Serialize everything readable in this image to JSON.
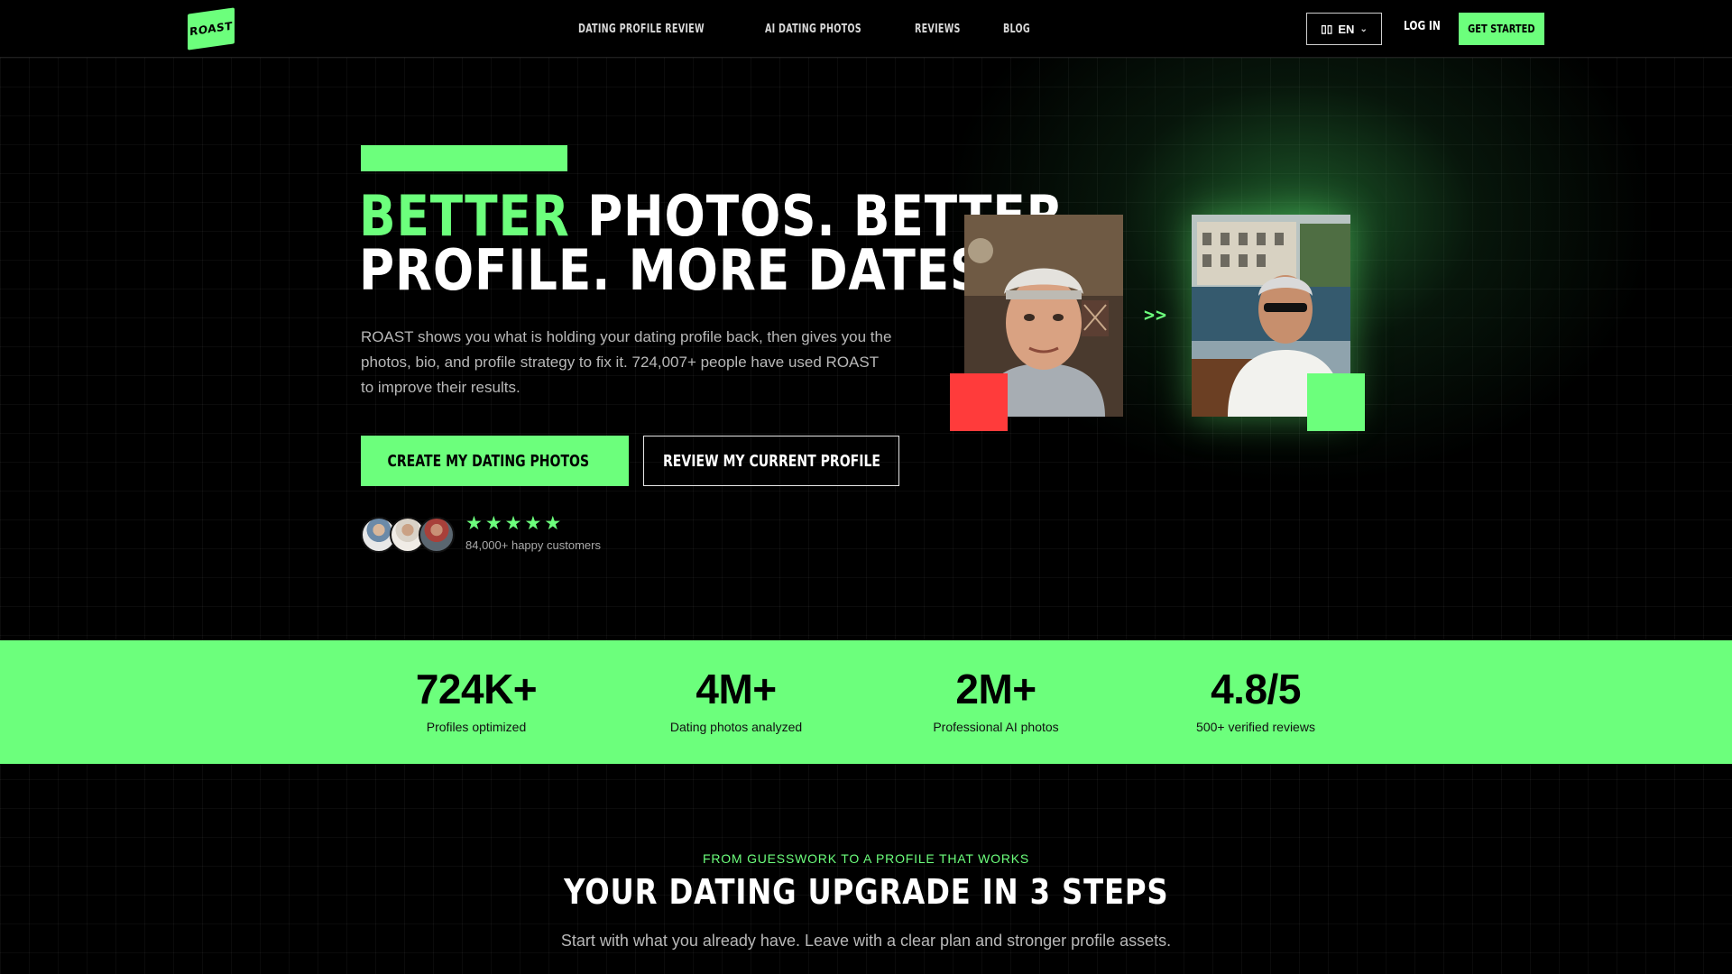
{
  "nav": {
    "logo_text": "ROAST",
    "links": [
      "Dating Profile Review",
      "AI Dating Photos",
      "Reviews",
      "Blog"
    ],
    "language": "EN",
    "language_flag": "flag-icon",
    "login_label": "Log in",
    "cta_label": "Get started"
  },
  "hero": {
    "headline_accent": "Better",
    "headline_rest_1": " photos. Better",
    "headline_line_2": "profile. More dates.",
    "subtext": "ROAST shows you what is holding your dating profile back, then gives you the photos, bio, and profile strategy to fix it. 724,007+ people have used ROAST to improve their results.",
    "primary_button": "Create my dating photos",
    "primary_button_icon": "arrow-right-icon",
    "secondary_button": "Review my current profile",
    "rating_stars": 5,
    "happy_customers": "84,000+ happy customers",
    "compare_arrows": ">>"
  },
  "stats": [
    {
      "value": "724K+",
      "label": "Profiles optimized"
    },
    {
      "value": "4M+",
      "label": "Dating photos analyzed"
    },
    {
      "value": "2M+",
      "label": "Professional AI photos"
    },
    {
      "value": "4.8/5",
      "label": "500+ verified reviews"
    }
  ],
  "steps": {
    "eyebrow": "From guesswork to a profile that works",
    "title": "Your dating upgrade in 3 steps",
    "subtitle": "Start with what you already have. Leave with a clear plan and stronger profile assets."
  },
  "colors": {
    "accent": "#6cff7c",
    "danger": "#ff3b3b",
    "background": "#000000"
  }
}
